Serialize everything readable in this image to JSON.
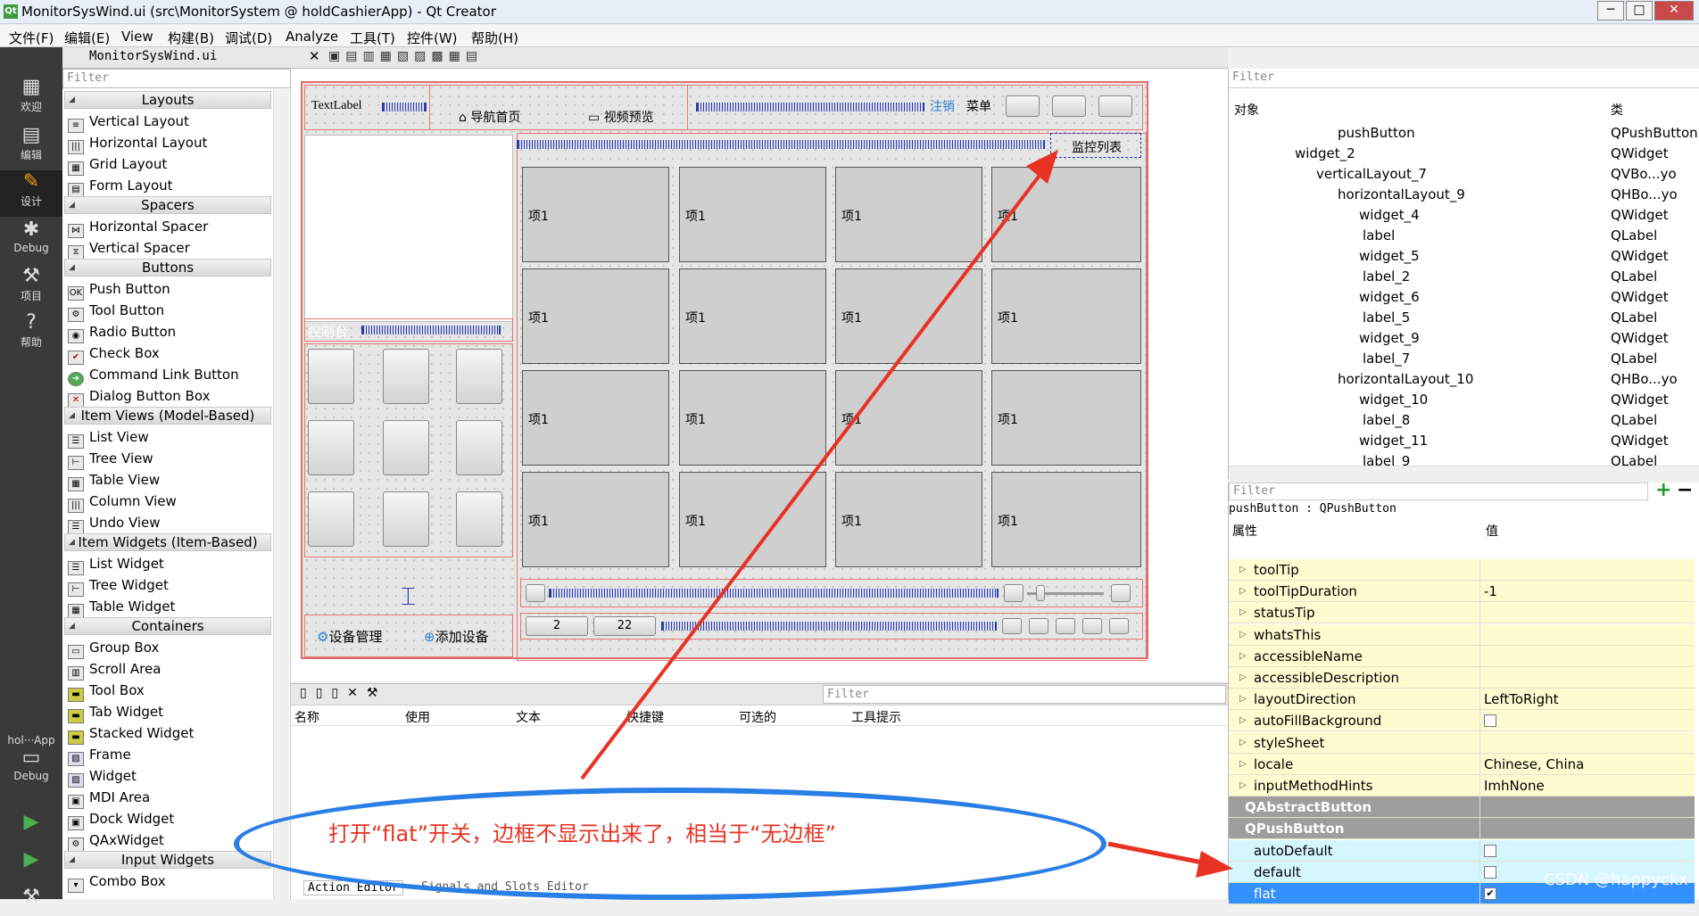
{
  "window": {
    "title": "MonitorSysWind.ui (src\\MonitorSystem @ holdCashierApp) - Qt Creator",
    "icon": "qt-icon",
    "min": "─",
    "max": "□",
    "close": "✕"
  },
  "menu": [
    "文件(F)",
    "编辑(E)",
    "View",
    "构建(B)",
    "调试(D)",
    "Analyze",
    "工具(T)",
    "控件(W)",
    "帮助(H)"
  ],
  "modes": [
    {
      "label": "欢迎",
      "icon": "grid-icon"
    },
    {
      "label": "编辑",
      "icon": "edit-icon"
    },
    {
      "label": "设计",
      "icon": "design-icon"
    },
    {
      "label": "Debug",
      "icon": "bug-icon"
    },
    {
      "label": "项目",
      "icon": "wrench-icon"
    },
    {
      "label": "帮助",
      "icon": "help-icon"
    }
  ],
  "kit": {
    "project": "hol···App",
    "label": "Debug"
  },
  "doc": {
    "file": "MonitorSysWind.ui"
  },
  "widgetbox": {
    "filter": "Filter",
    "categories": {
      "layouts": "Layouts",
      "spacers": "Spacers",
      "buttons": "Buttons",
      "itemviews": "Item Views (Model-Based)",
      "itemwidgets": "Item Widgets (Item-Based)",
      "containers": "Containers",
      "input": "Input Widgets"
    },
    "items": [
      "Vertical Layout",
      "Horizontal Layout",
      "Grid Layout",
      "Form Layout",
      "Horizontal Spacer",
      "Vertical Spacer",
      "Push Button",
      "Tool Button",
      "Radio Button",
      "Check Box",
      "Command Link Button",
      "Dialog Button Box",
      "List View",
      "Tree View",
      "Table View",
      "Column View",
      "Undo View",
      "List Widget",
      "Tree Widget",
      "Table Widget",
      "Group Box",
      "Scroll Area",
      "Tool Box",
      "Tab Widget",
      "Stacked Widget",
      "Frame",
      "Widget",
      "MDI Area",
      "Dock Widget",
      "QAxWidget",
      "Combo Box"
    ]
  },
  "form": {
    "textlabel": "TextLabel",
    "nav_home": "导航首页",
    "video_preview": "视频预览",
    "logout": "注销",
    "menu": "菜单",
    "monitor_list": "监控列表",
    "control": "控制台",
    "device_mgmt": "设备管理",
    "add_device": "添加设备",
    "cell": "项1",
    "page_a": "2",
    "page_b": "22"
  },
  "actioneditor": {
    "filter": "Filter",
    "columns": [
      "名称",
      "使用",
      "文本",
      "快捷键",
      "可选的",
      "工具提示"
    ],
    "tabs": [
      "Action Editor",
      "Signals and Slots Editor"
    ]
  },
  "objinspector": {
    "filter": "Filter",
    "col_object": "对象",
    "col_class": "类",
    "rows": [
      {
        "o": "pushButton",
        "c": "QPushButton",
        "d": 3
      },
      {
        "o": "widget_2",
        "c": "QWidget",
        "d": 1
      },
      {
        "o": "verticalLayout_7",
        "c": "QVBo...yo",
        "d": 2
      },
      {
        "o": "horizontalLayout_9",
        "c": "QHBo...yo",
        "d": 3
      },
      {
        "o": "widget_4",
        "c": "QWidget",
        "d": 4
      },
      {
        "o": "label",
        "c": "QLabel",
        "d": 5
      },
      {
        "o": "widget_5",
        "c": "QWidget",
        "d": 4
      },
      {
        "o": "label_2",
        "c": "QLabel",
        "d": 5
      },
      {
        "o": "widget_6",
        "c": "QWidget",
        "d": 4
      },
      {
        "o": "label_5",
        "c": "QLabel",
        "d": 5
      },
      {
        "o": "widget_9",
        "c": "QWidget",
        "d": 4
      },
      {
        "o": "label_7",
        "c": "QLabel",
        "d": 5
      },
      {
        "o": "horizontalLayout_10",
        "c": "QHBo...yo",
        "d": 3
      },
      {
        "o": "widget_10",
        "c": "QWidget",
        "d": 4
      },
      {
        "o": "label_8",
        "c": "QLabel",
        "d": 5
      },
      {
        "o": "widget_11",
        "c": "QWidget",
        "d": 4
      },
      {
        "o": "label_9",
        "c": "QLabel",
        "d": 5
      }
    ]
  },
  "propeditor": {
    "filter": "Filter",
    "object": "pushButton : QPushButton",
    "col_prop": "属性",
    "col_val": "值",
    "rows": [
      {
        "n": "toolTip",
        "v": "",
        "s": "y"
      },
      {
        "n": "toolTipDuration",
        "v": "-1",
        "s": "y"
      },
      {
        "n": "statusTip",
        "v": "",
        "s": "y"
      },
      {
        "n": "whatsThis",
        "v": "",
        "s": "y"
      },
      {
        "n": "accessibleName",
        "v": "",
        "s": "y"
      },
      {
        "n": "accessibleDescription",
        "v": "",
        "s": "y"
      },
      {
        "n": "layoutDirection",
        "v": "LeftToRight",
        "s": "y"
      },
      {
        "n": "autoFillBackground",
        "v": "",
        "s": "y",
        "chk": true
      },
      {
        "n": "styleSheet",
        "v": "",
        "s": "y"
      },
      {
        "n": "locale",
        "v": "Chinese, China",
        "s": "y"
      },
      {
        "n": "inputMethodHints",
        "v": "ImhNone",
        "s": "y"
      },
      {
        "n": "QAbstractButton",
        "v": "",
        "s": "grp"
      },
      {
        "n": "QPushButton",
        "v": "",
        "s": "grp"
      },
      {
        "n": "autoDefault",
        "v": "",
        "s": "c",
        "chk": true
      },
      {
        "n": "default",
        "v": "",
        "s": "c",
        "chk": true
      },
      {
        "n": "flat",
        "v": "",
        "s": "sel",
        "chk": true,
        "checked": true
      }
    ]
  },
  "annotation": {
    "text": "打开“flat”开关，边框不显示出来了，相当于“无边框”"
  },
  "watermark": "CSDN @happyckx",
  "colors": {
    "annotation_red": "#e83324",
    "ellipse_blue": "#2a7fe6",
    "selection": "#3390ff"
  }
}
